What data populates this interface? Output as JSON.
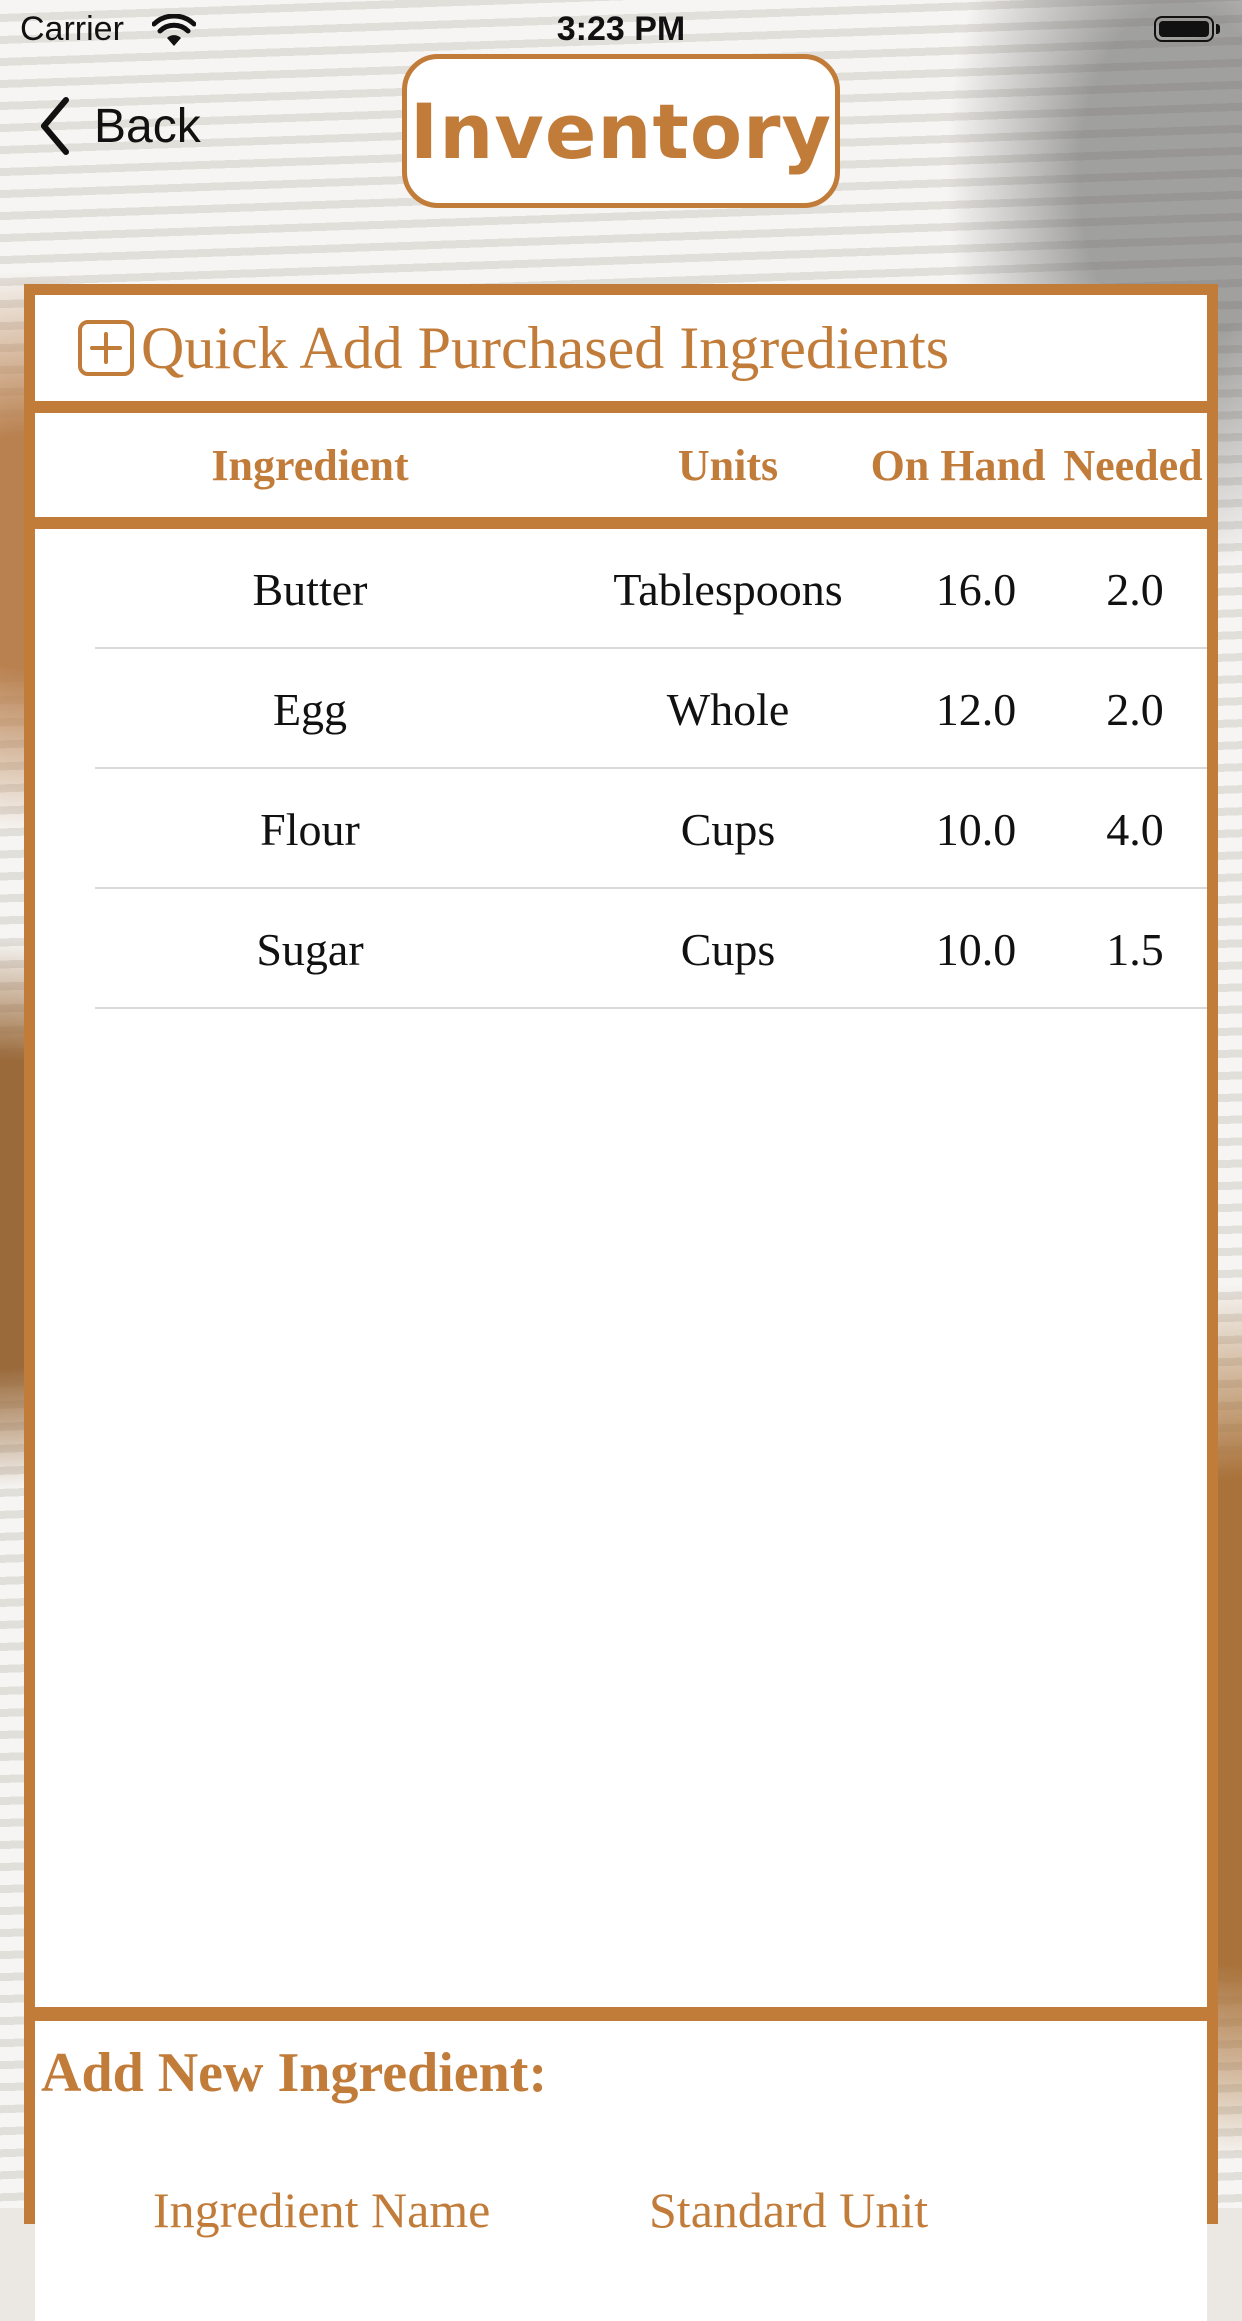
{
  "status_bar": {
    "carrier": "Carrier",
    "time": "3:23 PM"
  },
  "nav": {
    "back_label": "Back",
    "title": "Inventory"
  },
  "quick_add": {
    "label": "Quick Add Purchased Ingredients",
    "icon": "plus-square-icon"
  },
  "table": {
    "headers": {
      "ingredient": "Ingredient",
      "units": "Units",
      "on_hand": "On Hand",
      "needed": "Needed"
    },
    "rows": [
      {
        "ingredient": "Butter",
        "units": "Tablespoons",
        "on_hand": "16.0",
        "needed": "2.0"
      },
      {
        "ingredient": "Egg",
        "units": "Whole",
        "on_hand": "12.0",
        "needed": "2.0"
      },
      {
        "ingredient": "Flour",
        "units": "Cups",
        "on_hand": "10.0",
        "needed": "4.0"
      },
      {
        "ingredient": "Sugar",
        "units": "Cups",
        "on_hand": "10.0",
        "needed": "1.5"
      }
    ]
  },
  "add_new": {
    "title": "Add New Ingredient:",
    "ingredient_name_label": "Ingredient Name",
    "standard_unit_label": "Standard Unit"
  },
  "colors": {
    "accent": "#c27c3a",
    "text": "#111111",
    "separator": "#d9d9d9"
  }
}
